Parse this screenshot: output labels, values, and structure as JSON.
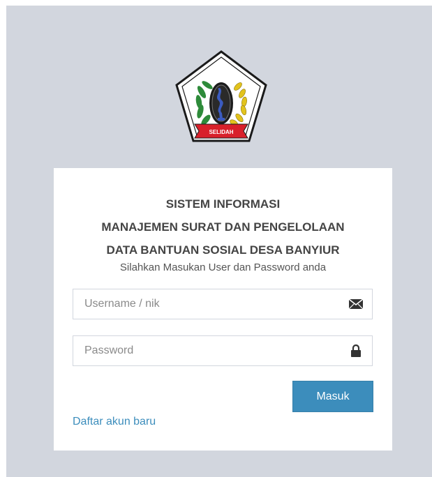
{
  "logo": {
    "name": "village-emblem-logo",
    "banner_text": "SELIDAH"
  },
  "login": {
    "title_line1": "SISTEM INFORMASI",
    "title_line2": "MANAJEMEN SURAT DAN PENGELOLAAN",
    "title_line3": "DATA BANTUAN SOSIAL DESA BANYIUR",
    "subtitle": "Silahkan Masukan User dan Password anda",
    "username": {
      "value": "",
      "placeholder": "Username / nik",
      "icon": "envelope-icon"
    },
    "password": {
      "value": "",
      "placeholder": "Password",
      "icon": "lock-icon"
    },
    "submit_label": "Masuk",
    "register_link": "Daftar akun baru"
  },
  "colors": {
    "background": "#d2d6de",
    "box": "#ffffff",
    "primary_button": "#3c8dbc",
    "link": "#3c8dbc",
    "title_text": "#444444"
  }
}
